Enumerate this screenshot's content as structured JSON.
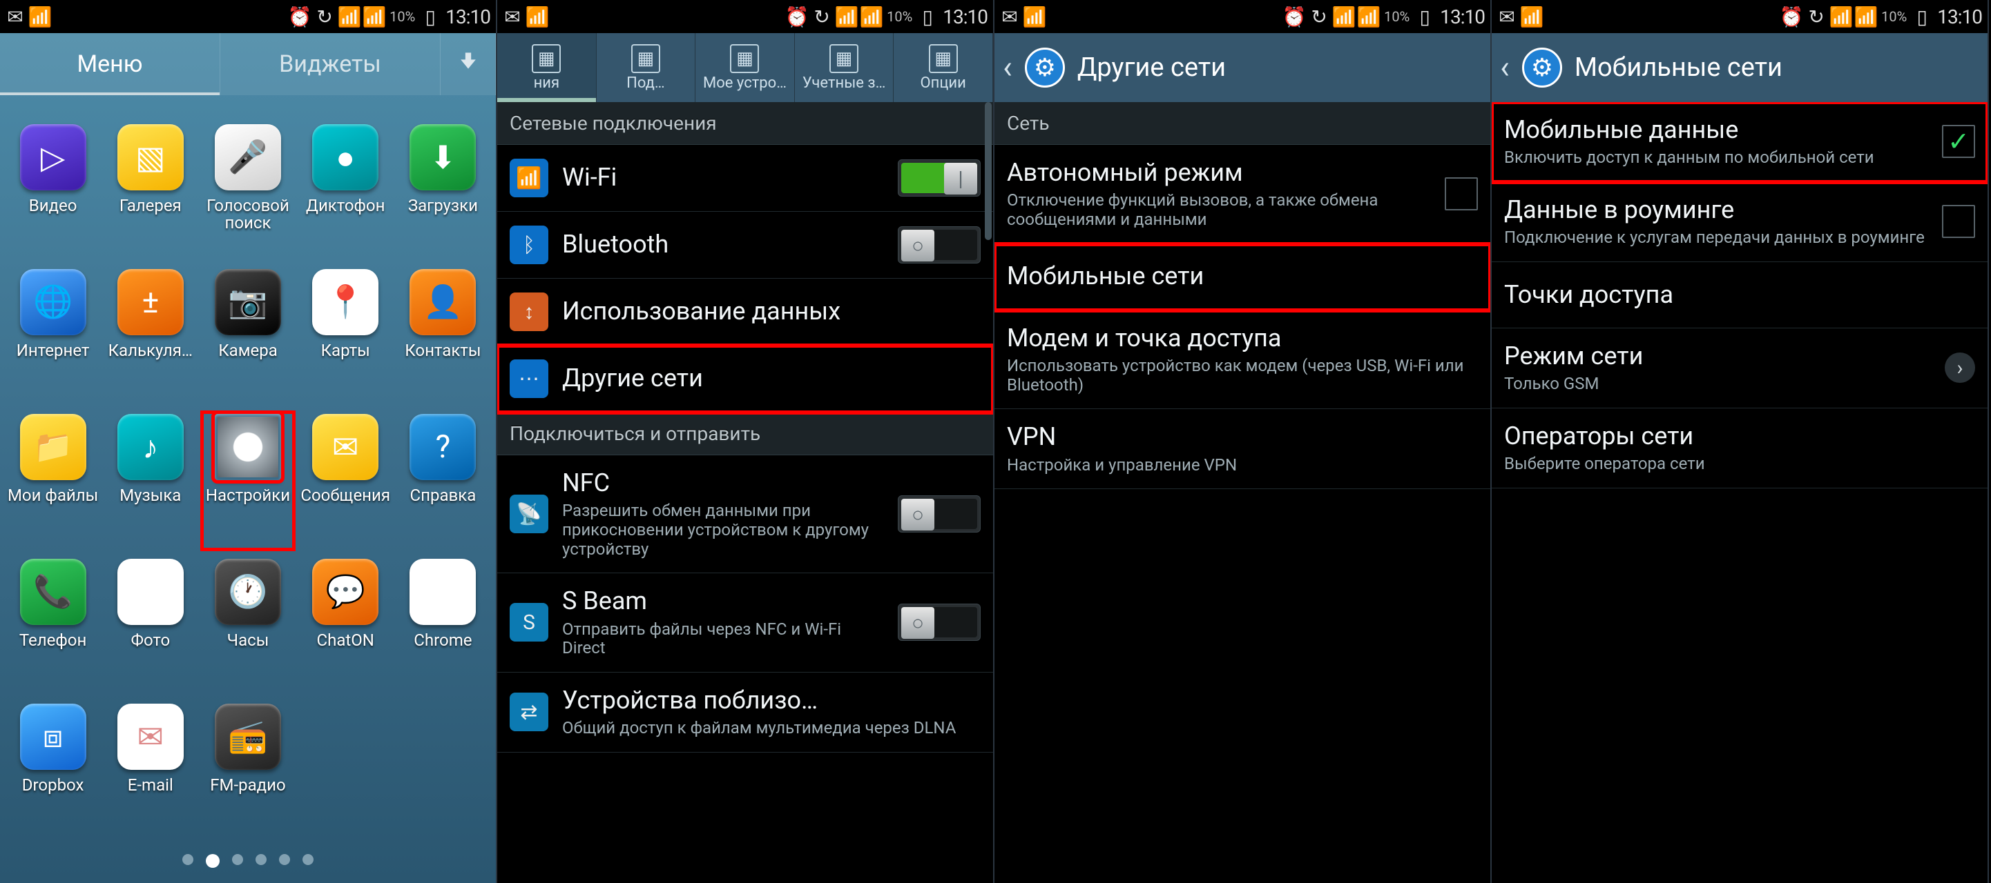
{
  "status": {
    "battery": "10%",
    "time": "13:10"
  },
  "screen1": {
    "tabs": {
      "menu": "Меню",
      "widgets": "Виджеты"
    },
    "apps": [
      {
        "label": "Видео",
        "cls": "c-purple",
        "glyph": "▷"
      },
      {
        "label": "Галерея",
        "cls": "c-yellow",
        "glyph": "▧"
      },
      {
        "label": "Голосовой поиск",
        "cls": "c-white",
        "glyph": "🎤"
      },
      {
        "label": "Диктофон",
        "cls": "c-teal",
        "glyph": "●"
      },
      {
        "label": "Загрузки",
        "cls": "c-green",
        "glyph": "⬇"
      },
      {
        "label": "Интернет",
        "cls": "c-blue",
        "glyph": "🌐"
      },
      {
        "label": "Калькуля…",
        "cls": "c-orange",
        "glyph": "±"
      },
      {
        "label": "Камера",
        "cls": "c-black",
        "glyph": "📷"
      },
      {
        "label": "Карты",
        "cls": "c-maps",
        "glyph": "📍"
      },
      {
        "label": "Контакты",
        "cls": "c-orange",
        "glyph": "👤"
      },
      {
        "label": "Мои файлы",
        "cls": "c-yellow",
        "glyph": "📁"
      },
      {
        "label": "Музыка",
        "cls": "c-teal",
        "glyph": "♪"
      },
      {
        "label": "Настройки",
        "cls": "c-gear",
        "glyph": "⚙",
        "highlight": true
      },
      {
        "label": "Сообщения",
        "cls": "c-yellow",
        "glyph": "✉"
      },
      {
        "label": "Справка",
        "cls": "c-help",
        "glyph": "?"
      },
      {
        "label": "Телефон",
        "cls": "c-green",
        "glyph": "📞"
      },
      {
        "label": "Фото",
        "cls": "c-gphotos",
        "glyph": "✦"
      },
      {
        "label": "Часы",
        "cls": "c-grey",
        "glyph": "🕐"
      },
      {
        "label": "ChatON",
        "cls": "c-orange",
        "glyph": "💬"
      },
      {
        "label": "Chrome",
        "cls": "c-chrome",
        "glyph": "◉"
      },
      {
        "label": "Dropbox",
        "cls": "c-dropbox",
        "glyph": "⧈"
      },
      {
        "label": "E-mail",
        "cls": "c-email",
        "glyph": "✉"
      },
      {
        "label": "FM-радио",
        "cls": "c-grey",
        "glyph": "📻"
      }
    ],
    "page_dots": 6,
    "active_dot": 1
  },
  "screen2": {
    "tabs": [
      "ния",
      "Под…",
      "Мое устро…",
      "Учетные з…",
      "Опции"
    ],
    "section_net": "Сетевые подключения",
    "rows_net": [
      {
        "title": "Wi-Fi",
        "iconcls": "ri-wifi",
        "glyph": "📶",
        "ctrl": "toggle-on"
      },
      {
        "title": "Bluetooth",
        "iconcls": "ri-bt",
        "glyph": "ᛒ",
        "ctrl": "toggle-off"
      },
      {
        "title": "Использование данных",
        "iconcls": "ri-data",
        "glyph": "↕"
      },
      {
        "title": "Другие сети",
        "iconcls": "ri-more",
        "glyph": "⋯",
        "highlight": true
      }
    ],
    "section_share": "Подключиться и отправить",
    "rows_share": [
      {
        "title": "NFC",
        "sub": "Разрешить обмен данными при прикосновении устройством к другому устройству",
        "iconcls": "ri-nfc",
        "glyph": "📡",
        "ctrl": "toggle-off"
      },
      {
        "title": "S Beam",
        "sub": "Отправить файлы через NFC и Wi-Fi Direct",
        "iconcls": "ri-sbeam",
        "glyph": "S",
        "ctrl": "toggle-off"
      },
      {
        "title": "Устройства поблизо…",
        "sub": "Общий доступ к файлам мультимедиа через DLNA",
        "iconcls": "ri-near",
        "glyph": "⇄"
      }
    ]
  },
  "screen3": {
    "title": "Другие сети",
    "section": "Сеть",
    "rows": [
      {
        "title": "Автономный режим",
        "sub": "Отключение функций вызовов, а также обмена сообщениями и данными",
        "ctrl": "checkbox-off"
      },
      {
        "title": "Мобильные сети",
        "highlight": true
      },
      {
        "title": "Модем и точка доступа",
        "sub": "Использовать устройство как модем (через USB, Wi-Fi или Bluetooth)"
      },
      {
        "title": "VPN",
        "sub": "Настройка и управление VPN"
      }
    ]
  },
  "screen4": {
    "title": "Мобильные сети",
    "rows": [
      {
        "title": "Мобильные данные",
        "sub": "Включить доступ к данным по мобильной сети",
        "ctrl": "checkbox-on",
        "highlight": true
      },
      {
        "title": "Данные в роуминге",
        "sub": "Подключение к услугам передачи данных в роуминге",
        "ctrl": "checkbox-off"
      },
      {
        "title": "Точки доступа"
      },
      {
        "title": "Режим сети",
        "sub": "Только GSM",
        "ctrl": "chevron"
      },
      {
        "title": "Операторы сети",
        "sub": "Выберите оператора сети"
      }
    ]
  }
}
